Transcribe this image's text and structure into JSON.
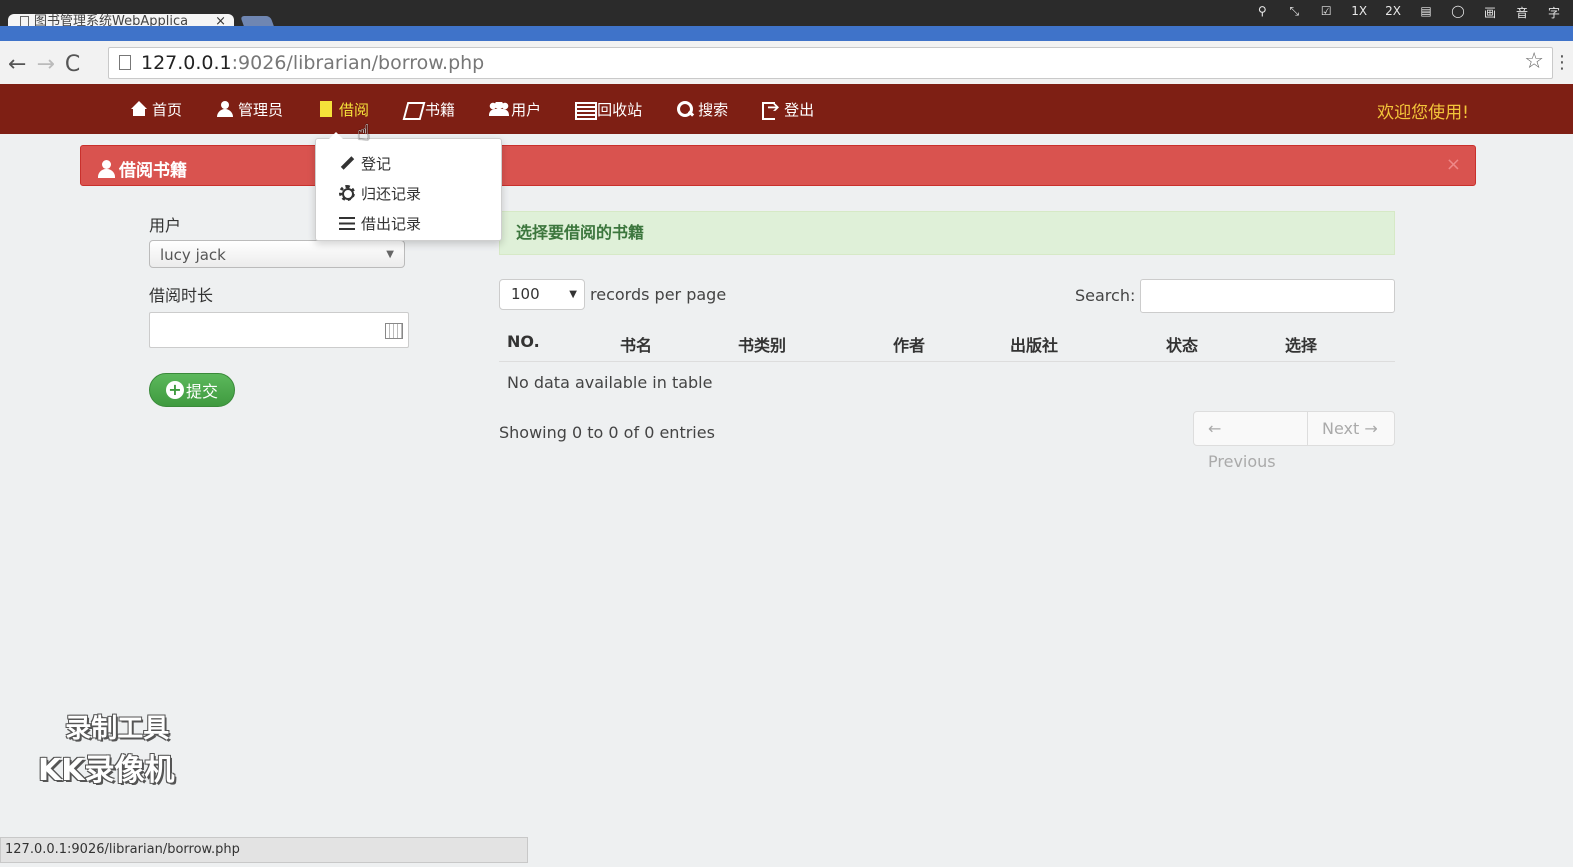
{
  "browser": {
    "tab_title": "图书管理系统WebApplica",
    "tab_close": "×",
    "url_host": "127.0.0.1",
    "url_path": ":9026/librarian/borrow.php",
    "status_url": "127.0.0.1:9026/librarian/borrow.php",
    "back": "←",
    "forward": "→",
    "reload": "C",
    "menu": "⋮",
    "star": "☆"
  },
  "system_tools": [
    "1X",
    "2X",
    "画",
    "音",
    "字"
  ],
  "nav": {
    "items": [
      {
        "label": "首页",
        "icon": "home-icon"
      },
      {
        "label": "管理员",
        "icon": "user-icon"
      },
      {
        "label": "借阅",
        "icon": "file-icon",
        "active": true
      },
      {
        "label": "书籍",
        "icon": "book-icon"
      },
      {
        "label": "用户",
        "icon": "users-icon"
      },
      {
        "label": "回收站",
        "icon": "list-alt-icon"
      },
      {
        "label": "搜索",
        "icon": "search-icon"
      },
      {
        "label": "登出",
        "icon": "sign-out-icon"
      }
    ],
    "welcome": "欢迎您使用!"
  },
  "dropdown": {
    "items": [
      {
        "label": "登记",
        "icon": "pencil-icon"
      },
      {
        "label": "归还记录",
        "icon": "cog-icon"
      },
      {
        "label": "借出记录",
        "icon": "list-icon"
      }
    ]
  },
  "panel": {
    "title": "借阅书籍",
    "close": "×"
  },
  "form": {
    "user_label": "用户",
    "user_value": "lucy jack",
    "duration_label": "借阅时长",
    "duration_value": "",
    "submit_label": "提交"
  },
  "table": {
    "alert": "选择要借阅的书籍",
    "page_length": "100",
    "length_text": "records per page",
    "search_label": "Search:",
    "search_value": "",
    "headers": [
      "NO.",
      "书名",
      "书类别",
      "作者",
      "出版社",
      "状态",
      "选择"
    ],
    "empty_text": "No data available in table",
    "info": "Showing 0 to 0 of 0 entries",
    "prev": "← Previous",
    "next": "Next →"
  },
  "watermark": {
    "line1": "录制工具",
    "line2": "KK录像机"
  },
  "colors": {
    "navbar": "#7e1f14",
    "panel_header": "#d9534f",
    "active_nav": "#f5e23a",
    "welcome": "#f3c53a",
    "submit": "#5cb85c",
    "alert_bg": "#dff0d8"
  }
}
